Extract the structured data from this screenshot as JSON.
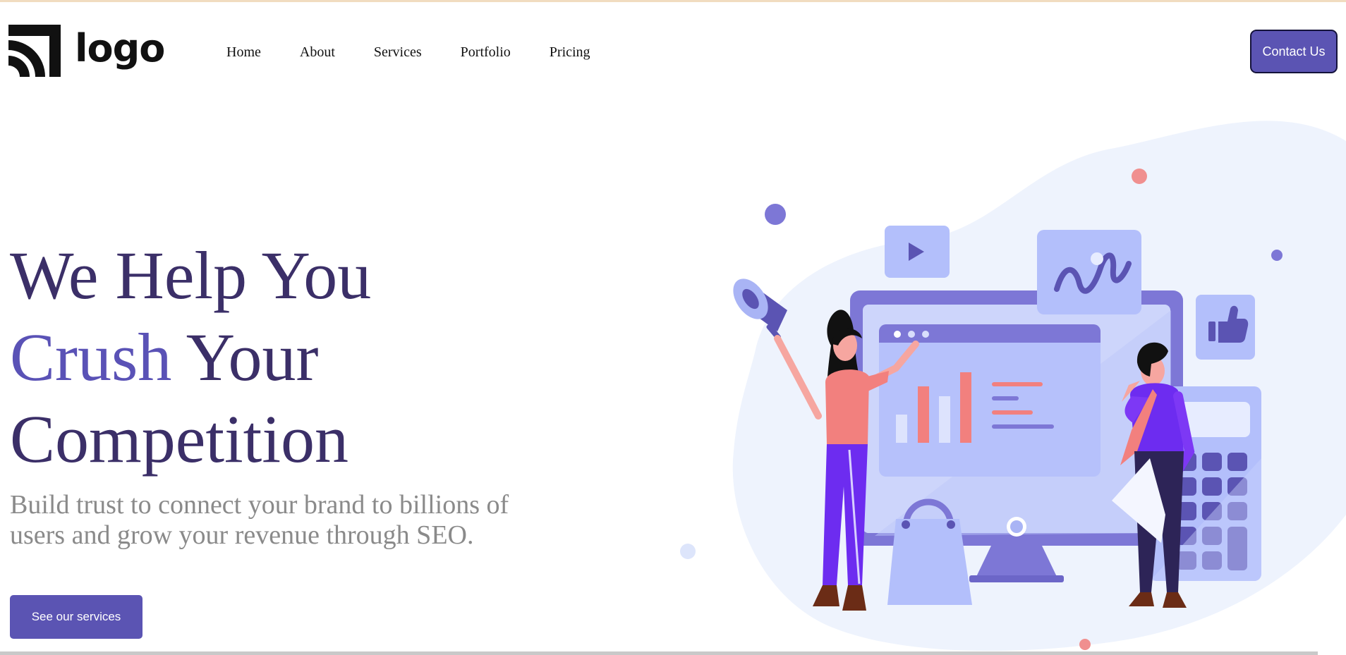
{
  "header": {
    "logo_text": "logo",
    "nav": [
      "Home",
      "About",
      "Services",
      "Portfolio",
      "Pricing"
    ],
    "contact_label": "Contact Us"
  },
  "hero": {
    "title_line1": "We Help You",
    "title_accent": "Crush",
    "title_line2_rest": " Your",
    "title_line3": "Competition",
    "subtitle": "Build trust to connect your brand to billions of users and grow your revenue through SEO.",
    "cta_label": "See our services"
  },
  "colors": {
    "primary": "#5b54b3",
    "heading": "#3b2f68",
    "accent": "#5a52b6",
    "subtitle": "#8a8a8a",
    "top_line": "#f1dcc0"
  },
  "icons": [
    "logo-mark-icon",
    "play-icon",
    "wave-chart-icon",
    "thumbs-up-icon",
    "megaphone-icon",
    "shopping-bag-icon",
    "calculator-icon"
  ]
}
